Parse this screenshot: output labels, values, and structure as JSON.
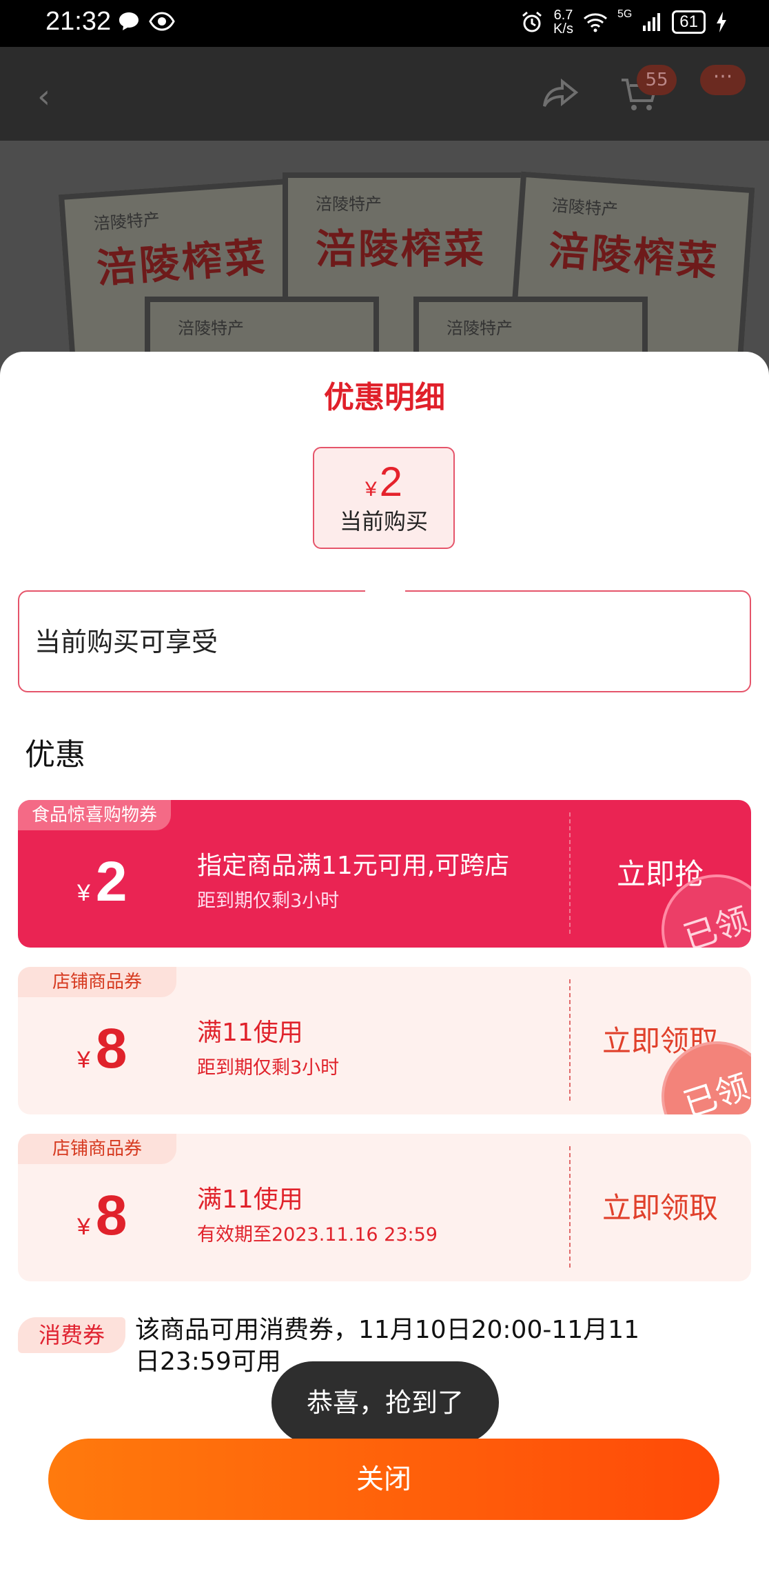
{
  "status_bar": {
    "time": "21:32",
    "net_speed_value": "6.7",
    "net_speed_unit": "K/s",
    "network": "5G",
    "battery": "61"
  },
  "background": {
    "cart_count": "55",
    "product_brand": "涪陵特产",
    "product_title": "涪陵榨菜"
  },
  "sheet": {
    "title": "优惠明细",
    "price": {
      "currency": "¥",
      "amount": "2",
      "label": "当前购买"
    },
    "tip": "当前购买可享受",
    "section_title": "优惠",
    "coupons": [
      {
        "tag": "食品惊喜购物券",
        "currency": "¥",
        "amount": "2",
        "desc": "指定商品满11元可用,可跨店",
        "sub": "距到期仅剩3小时",
        "action": "立即抢",
        "stamp": "已领"
      },
      {
        "tag": "店铺商品券",
        "currency": "¥",
        "amount": "8",
        "desc": "满11使用",
        "sub": "距到期仅剩3小时",
        "action": "立即领取",
        "stamp": "已领"
      },
      {
        "tag": "店铺商品券",
        "currency": "¥",
        "amount": "8",
        "desc": "满11使用",
        "sub": "有效期至2023.11.16 23:59",
        "action": "立即领取"
      }
    ],
    "consume": {
      "tag": "消费券",
      "text": "该商品可用消费券，11月10日20:00-11月11日23:59可用"
    },
    "toast": "恭喜，抢到了",
    "close_label": "关闭"
  },
  "colors": {
    "accent_red": "#e0202a",
    "coupon_red": "#ea2453",
    "close_gradient_start": "#ff7a0d",
    "close_gradient_end": "#ff4a08"
  }
}
